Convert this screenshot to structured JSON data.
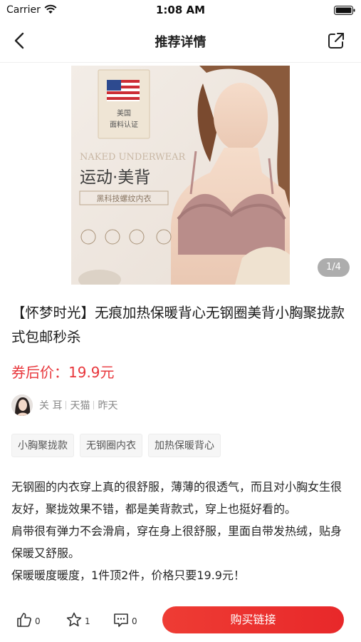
{
  "status_bar": {
    "carrier": "Carrier",
    "time": "1:08 AM"
  },
  "nav": {
    "title": "推荐详情",
    "back_icon": "chevron-left-icon",
    "share_icon": "share-external-icon"
  },
  "product": {
    "image_caption": "美国面料认证 · NAKED UNDERWEAR · 运动·美背 · 黑科技螺纹内衣",
    "image_badge_line1": "美国",
    "image_badge_line2": "面料认证",
    "image_brand_text": "NAKED UNDERWEAR",
    "image_headline": "运动·美背",
    "image_subline": "黑科技螺纹内衣",
    "image_counter": "1/4",
    "title": "【怀梦时光】无痕加热保暖背心无钢圈美背小胸聚拢款式包邮秒杀",
    "price_label": "券后价：19.9元"
  },
  "author": {
    "name": "关 耳",
    "platform": "天猫",
    "time": "昨天"
  },
  "tags": [
    "小胸聚拢款",
    "无钢圈内衣",
    "加热保暖背心"
  ],
  "description": {
    "p1": "无钢圈的内衣穿上真的很舒服，薄薄的很透气，而且对小胸女生很友好，聚拢效果不错，都是美背款式，穿上也挺好看的。",
    "p2": "肩带很有弹力不会滑肩，穿在身上很舒服，里面自带发热绒，贴身保暖又舒服。",
    "p3": "保暖暖度暖度，1件顶2件，价格只要19.9元！"
  },
  "bottom_bar": {
    "like_count": "0",
    "favorite_count": "1",
    "comment_count": "0",
    "buy_label": "购买链接"
  },
  "colors": {
    "accent_red": "#e8363b",
    "button_red": "#ec3330"
  }
}
